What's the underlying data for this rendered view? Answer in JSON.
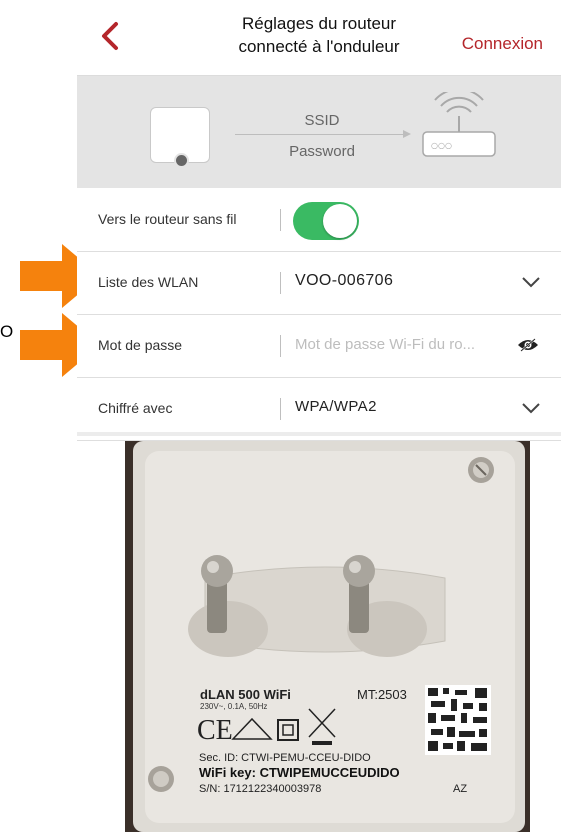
{
  "header": {
    "back_label": "<",
    "title_line1": "Réglages du routeur",
    "title_line2": "connecté à l'onduleur",
    "connect_label": "Connexion",
    "accent_color": "#b4262b"
  },
  "diagram": {
    "ssid_label": "SSID",
    "password_label": "Password",
    "router_leds": "○○○"
  },
  "rows": {
    "wireless": {
      "label": "Vers le routeur sans fil",
      "toggle_on": true,
      "toggle_color": "#3aba63"
    },
    "wlan": {
      "label": "Liste des WLAN",
      "value": "VOO-006706"
    },
    "password": {
      "label": "Mot de passe",
      "placeholder": "Mot de passe Wi-Fi du ro..."
    },
    "encryption": {
      "label": "Chiffré avec",
      "value": "WPA/WPA2"
    }
  },
  "edge_text": "O",
  "annotation_color": "#f5820d",
  "label_plate": {
    "product": "dLAN 500 WiFi",
    "mt": "MT:2503",
    "rating": "230V~, 0.1A, 50Hz",
    "ce": "CE",
    "sec_id": "Sec. ID: CTWI-PEMU-CCEU-DIDO",
    "wifi_key": "WiFi key: CTWIPEMUCCEUDIDO",
    "sn": "S/N: 1712122340003978",
    "code": "AZ"
  }
}
